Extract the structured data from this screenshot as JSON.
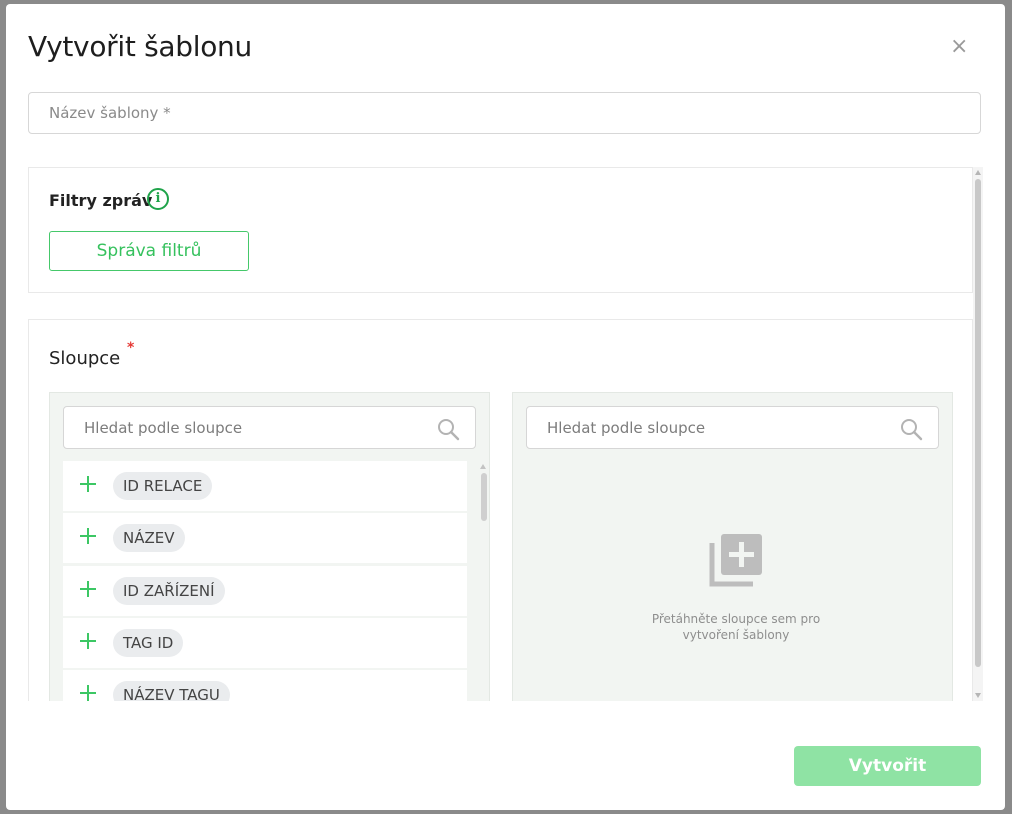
{
  "dialog": {
    "title": "Vytvořit šablonu",
    "close_symbol": "×",
    "name_placeholder": "Název šablony *"
  },
  "filters": {
    "title": "Filtry zpráv",
    "info_symbol": "i",
    "manage_button": "Správa filtrů"
  },
  "columns": {
    "title": "Sloupce",
    "required_mark": "*",
    "search_placeholder_left": "Hledat podle sloupce",
    "search_placeholder_right": "Hledat podle sloupce",
    "items": [
      {
        "label": "ID RELACE"
      },
      {
        "label": "NÁZEV"
      },
      {
        "label": "ID ZAŘÍZENÍ"
      },
      {
        "label": "TAG ID"
      },
      {
        "label": "NÁZEV TAGU"
      }
    ],
    "drop_hint": "Přetáhněte sloupce sem pro vytvoření šablony"
  },
  "footer": {
    "create_button": "Vytvořit"
  },
  "colors": {
    "accent_green": "#35c15d",
    "disabled_button": "#8fe3a4",
    "info_green": "#1fa34a",
    "required_red": "#e53935"
  }
}
